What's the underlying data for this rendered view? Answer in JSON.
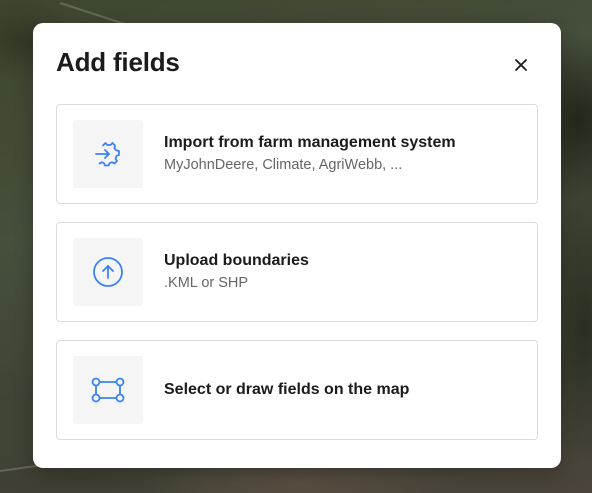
{
  "dialog": {
    "title": "Add fields",
    "close_icon": "close-icon"
  },
  "options": [
    {
      "icon": "import-gear-icon",
      "title": "Import from farm management system",
      "subtitle": "MyJohnDeere, Climate, AgriWebb, ..."
    },
    {
      "icon": "upload-arrow-icon",
      "title": "Upload boundaries",
      "subtitle": ".KML or SHP"
    },
    {
      "icon": "draw-shape-icon",
      "title": "Select or draw fields on the map",
      "subtitle": ""
    }
  ],
  "colors": {
    "accent": "#3b82f6",
    "title_text": "#1b1b1b",
    "subtitle_text": "#666666",
    "card_border": "#dcdcdc",
    "icon_box_bg": "#f5f5f5"
  }
}
